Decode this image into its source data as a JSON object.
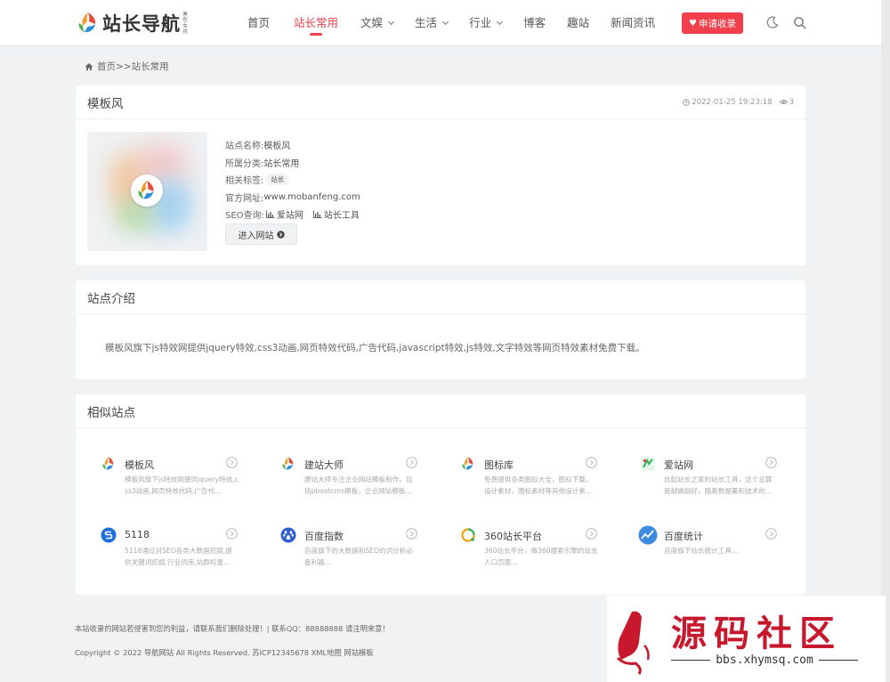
{
  "header": {
    "logo_text": "站长导航",
    "logo_sub": "黑色女孩",
    "nav": [
      {
        "label": "首页"
      },
      {
        "label": "站长常用"
      },
      {
        "label": "文娱"
      },
      {
        "label": "生活"
      },
      {
        "label": "行业"
      },
      {
        "label": "博客"
      },
      {
        "label": "趣站"
      },
      {
        "label": "新闻资讯"
      }
    ],
    "active_nav": "站长常用",
    "apply_label": "申请收录"
  },
  "breadcrumb": "首页>>站长常用",
  "site": {
    "name": "模板风",
    "date": "2022-01-25 19:23:18",
    "views": "3",
    "fields": {
      "name_label": "站点名称:",
      "name_value": "模板风",
      "category_label": "所属分类:",
      "category_value": "站长常用",
      "tags_label": "相关标签:",
      "tag": "站长",
      "url_label": "官方网址:",
      "url_value": "www.mobanfeng.com",
      "seo_label": "SEO查询:",
      "seo_links": [
        "爱站网",
        "站长工具"
      ]
    },
    "visit_label": "进入网站"
  },
  "intro": {
    "title": "站点介绍",
    "text": "模板风旗下js特效网提供jquery特效,css3动画,网页特效代码,广告代码,javascript特效,js特效,文字特效等网页特效素材免费下载。"
  },
  "similar": {
    "title": "相似站点",
    "items": [
      {
        "name": "模板风",
        "desc": "模板风旗下js特效网提供jquery特效,css3动画,网页特效代码,广告代...",
        "icon": "logo-icon"
      },
      {
        "name": "建站大师",
        "desc": "建站大师专注企业网站模板制作，包括pbootcms模板，企业网站模板...",
        "icon": "logo-icon"
      },
      {
        "name": "图标库",
        "desc": "免费提供各类图标大全，图标下载，设计素材，图标素材等其他设计素...",
        "icon": "logo-icon"
      },
      {
        "name": "爱站网",
        "desc": "比起站长之家的站长工具，这个总算是越做越好，随着数据量和技术的...",
        "icon": "aizhan-icon"
      },
      {
        "name": "5118",
        "desc": "5118通过对SEO各类大数据挖掘,提供关键词挖掘,行业词库,站群权重...",
        "icon": "5118-icon"
      },
      {
        "name": "百度指数",
        "desc": "百度旗下的大数据和SEO的词分析必备利器...",
        "icon": "baidu-paw-icon"
      },
      {
        "name": "360站长平台",
        "desc": "360站长平台，做360搜索引擎的站长入口页面...",
        "icon": "360-icon"
      },
      {
        "name": "百度统计",
        "desc": "百度旗下站长统计工具...",
        "icon": "baidu-tongji-icon"
      }
    ]
  },
  "footer": {
    "line1": "本站收录的网站若侵害到您的利益，请联系我们删除处理！| 联系QQ：88888888 请注明来意！",
    "line2": "Copyright © 2022 导航网站 All Rights Reserved. 苏ICP12345678 XML地图 网站模板"
  },
  "watermark": {
    "title": "源码社区",
    "url": "bbs.xhymsq.com",
    "seal_text": "小依"
  },
  "colors": {
    "accent": "#f1404b",
    "background": "#f1f2f3",
    "watermark_red": "#c8182e"
  }
}
